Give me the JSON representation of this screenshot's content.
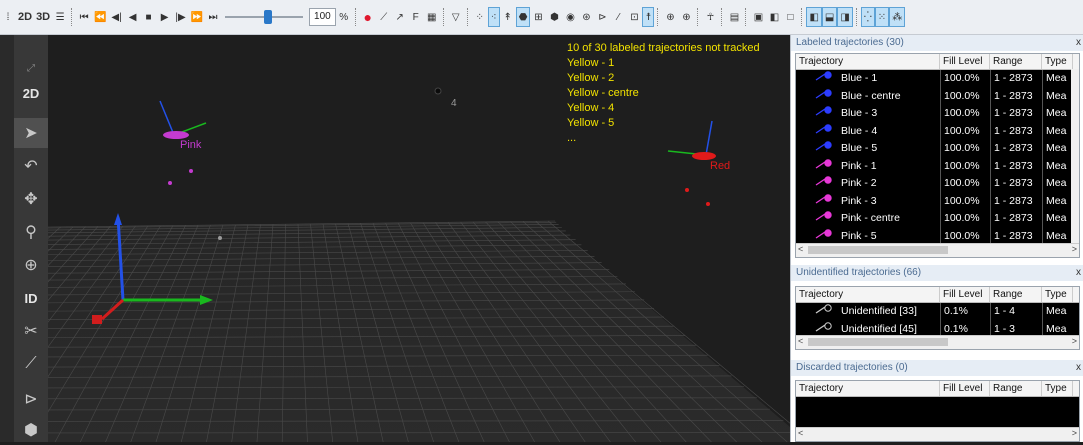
{
  "toolbar": {
    "view_2d": "2D",
    "view_3d": "3D",
    "speed_value": "100",
    "speed_unit": "%",
    "playback_position": 0.55,
    "f_label": "F"
  },
  "left_tools": {
    "two_d_label": "2D",
    "id_label": "ID"
  },
  "viewport": {
    "info_lines": [
      "10 of 30 labeled trajectories not tracked",
      "Yellow - 1",
      "Yellow - 2",
      "Yellow - centre",
      "Yellow - 4",
      "Yellow - 5",
      "..."
    ],
    "markers": {
      "pink_label": "Pink",
      "red_label": "Red",
      "marker_4_label": "4"
    },
    "colors": {
      "info_text": "#f2e200",
      "pink": "#c43bd0",
      "red": "#e01a1a",
      "x_axis": "#19b81e",
      "y_axis": "#2351e8",
      "z_axis": "#d11d1d"
    }
  },
  "panel": {
    "labeled": {
      "title": "Labeled trajectories (30)",
      "columns": [
        "Trajectory",
        "Fill Level",
        "Range",
        "Type"
      ],
      "rows": [
        {
          "name": "Blue - 1",
          "fill": "100.0%",
          "range": "1 - 2873",
          "type": "Mea",
          "color": "#2c3cff"
        },
        {
          "name": "Blue - centre",
          "fill": "100.0%",
          "range": "1 - 2873",
          "type": "Mea",
          "color": "#2c3cff"
        },
        {
          "name": "Blue - 3",
          "fill": "100.0%",
          "range": "1 - 2873",
          "type": "Mea",
          "color": "#2c3cff"
        },
        {
          "name": "Blue - 4",
          "fill": "100.0%",
          "range": "1 - 2873",
          "type": "Mea",
          "color": "#2c3cff"
        },
        {
          "name": "Blue - 5",
          "fill": "100.0%",
          "range": "1 - 2873",
          "type": "Mea",
          "color": "#2c3cff"
        },
        {
          "name": "Pink - 1",
          "fill": "100.0%",
          "range": "1 - 2873",
          "type": "Mea",
          "color": "#e838d8"
        },
        {
          "name": "Pink - 2",
          "fill": "100.0%",
          "range": "1 - 2873",
          "type": "Mea",
          "color": "#e838d8"
        },
        {
          "name": "Pink - 3",
          "fill": "100.0%",
          "range": "1 - 2873",
          "type": "Mea",
          "color": "#e838d8"
        },
        {
          "name": "Pink - centre",
          "fill": "100.0%",
          "range": "1 - 2873",
          "type": "Mea",
          "color": "#e838d8"
        },
        {
          "name": "Pink - 5",
          "fill": "100.0%",
          "range": "1 - 2873",
          "type": "Mea",
          "color": "#e838d8"
        }
      ]
    },
    "unidentified": {
      "title": "Unidentified trajectories (66)",
      "columns": [
        "Trajectory",
        "Fill Level",
        "Range",
        "Type"
      ],
      "rows": [
        {
          "name": "Unidentified [33]",
          "fill": "0.1%",
          "range": "1 - 4",
          "type": "Mea",
          "color": "#cccccc"
        },
        {
          "name": "Unidentified [45]",
          "fill": "0.1%",
          "range": "1 - 3",
          "type": "Mea",
          "color": "#cccccc"
        }
      ]
    },
    "discarded": {
      "title": "Discarded trajectories (0)",
      "columns": [
        "Trajectory",
        "Fill Level",
        "Range",
        "Type"
      ],
      "rows": []
    },
    "close_glyph": "x",
    "scroll_left": "<",
    "scroll_right": ">"
  }
}
